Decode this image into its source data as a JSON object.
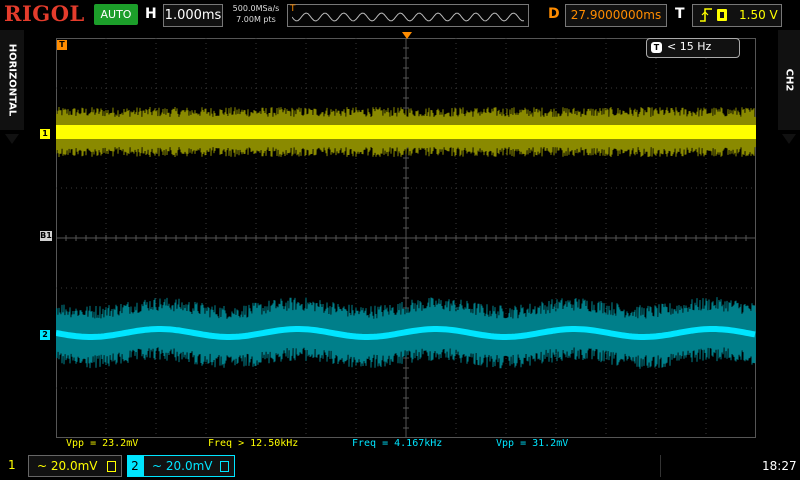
{
  "brand": "RIGOL",
  "run_mode": "AUTO",
  "timebase": {
    "label": "H",
    "value": "1.000ms"
  },
  "acquisition": {
    "sample_rate": "500.0MSa/s",
    "memory_depth": "7.00M pts"
  },
  "trigger_delay": {
    "label": "D",
    "value": "27.9000000ms"
  },
  "trigger": {
    "label": "T",
    "level": "1.50 V",
    "edge_icon": "rising-edge-icon",
    "source_icon": "ch1-source-icon"
  },
  "side_tabs": {
    "left": "HORIZONTAL",
    "right": "CH2"
  },
  "filter_badge": {
    "icon": "T",
    "text": "< 15 Hz"
  },
  "markers": {
    "T": "T",
    "ch1": "1",
    "ch2": "2",
    "b1": "B1"
  },
  "measurements": [
    {
      "text": "Vpp = 23.2mV",
      "color": "#ffff00"
    },
    {
      "text": "Freq > 12.50kHz",
      "color": "#ffff00"
    },
    {
      "text": "Freq = 4.167kHz",
      "color": "#00e5ff"
    },
    {
      "text": "Vpp = 31.2mV",
      "color": "#00e5ff"
    }
  ],
  "channels": [
    {
      "number": "1",
      "scale": "~ 20.0mV",
      "color": "#ffff00"
    },
    {
      "number": "2",
      "scale": "~ 20.0mV",
      "color": "#00e5ff"
    }
  ],
  "clock": "18:27",
  "colors": {
    "ch1": "#ffff00",
    "ch1_noise": "#8a8a00",
    "ch2": "#00e5ff",
    "ch2_noise": "#007f8a",
    "accent": "#ff8c00",
    "brand": "#e43c2c",
    "run": "#1c9e2a"
  }
}
